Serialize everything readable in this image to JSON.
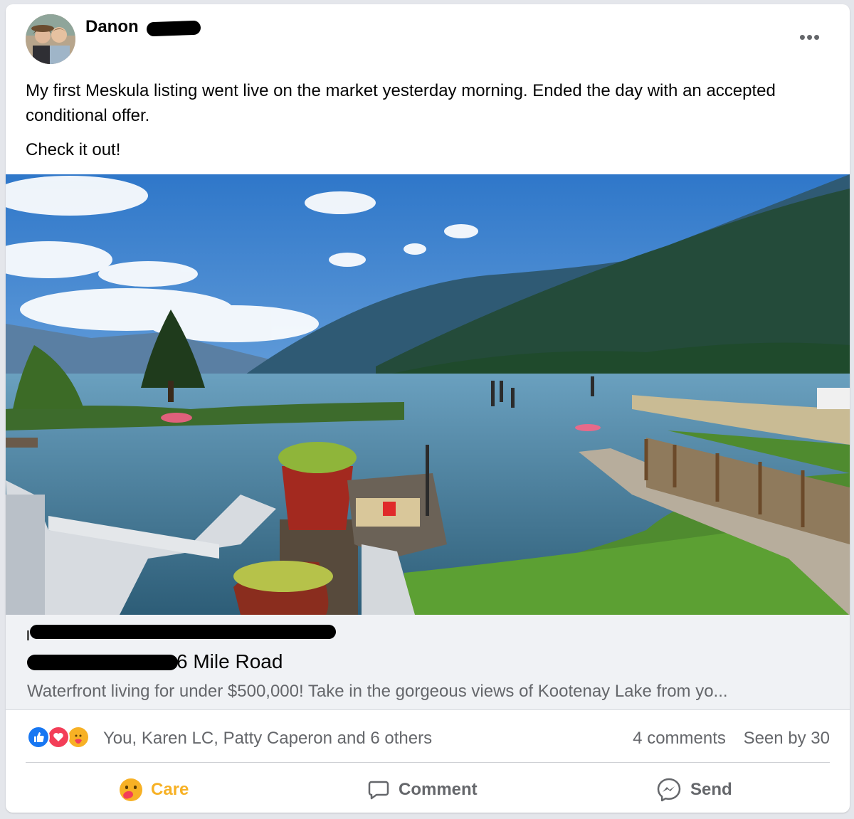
{
  "post": {
    "author": "Danon",
    "more_glyph": "•••",
    "paragraphs": [
      "My first Meskula listing went live on the market yesterday morning.  Ended the day with an accepted conditional offer.",
      "Check it out!"
    ]
  },
  "link_preview": {
    "title_suffix": "6 Mile Road",
    "description": "Waterfront living for under $500,000! Take in the gorgeous views of Kootenay Lake from yo..."
  },
  "reactions": {
    "icons": [
      "like-icon",
      "love-icon",
      "care-icon"
    ],
    "names": "You, Karen LC, Patty Caperon and 6 others",
    "comments": "4 comments",
    "seen": "Seen by 30"
  },
  "actions": {
    "care_label": "Care",
    "comment_label": "Comment",
    "send_label": "Send"
  },
  "colors": {
    "accent_care": "#f7b125",
    "like_blue": "#1877f2",
    "love_red": "#f33e58",
    "muted_text": "#65676b"
  }
}
